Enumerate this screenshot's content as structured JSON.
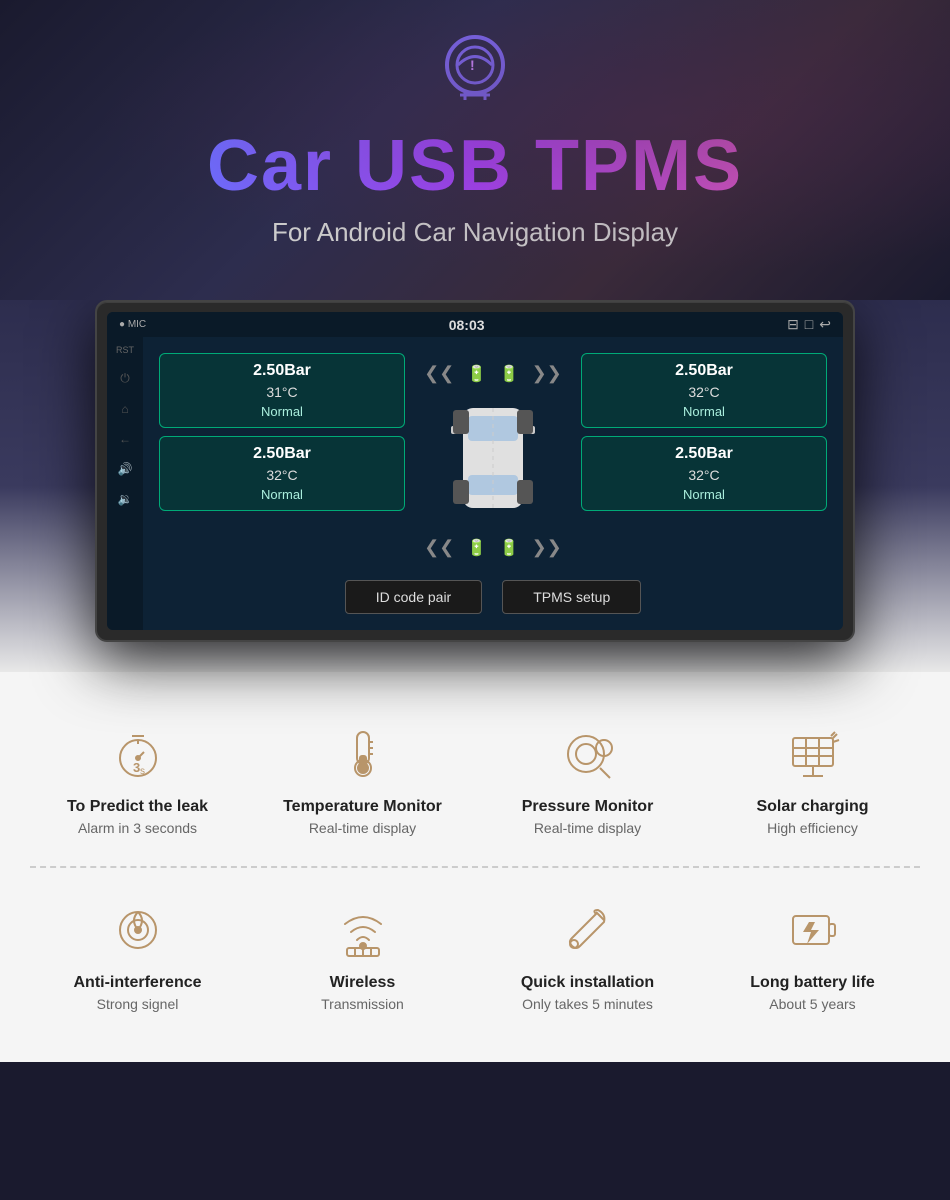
{
  "hero": {
    "icon_label": "TPMS tire pressure icon",
    "title": "Car USB TPMS",
    "subtitle": "For Android Car Navigation Display"
  },
  "device": {
    "topbar": {
      "left": "MIC  RST",
      "time": "08:03",
      "right_icons": [
        "≡",
        "□",
        "↩"
      ]
    },
    "sidebar_icons": [
      "⌂",
      "↩",
      "↑",
      "↓"
    ],
    "tires": {
      "front_left": {
        "bar": "2.50Bar",
        "temp": "31°C",
        "status": "Normal"
      },
      "front_right": {
        "bar": "2.50Bar",
        "temp": "32°C",
        "status": "Normal"
      },
      "rear_left": {
        "bar": "2.50Bar",
        "temp": "32°C",
        "status": "Normal"
      },
      "rear_right": {
        "bar": "2.50Bar",
        "temp": "32°C",
        "status": "Normal"
      }
    },
    "buttons": {
      "id_code": "ID code pair",
      "tpms_setup": "TPMS setup"
    }
  },
  "features_row1": [
    {
      "id": "predict-leak",
      "title": "To Predict the leak",
      "desc": "Alarm in 3 seconds",
      "icon": "timer"
    },
    {
      "id": "temperature",
      "title": "Temperature Monitor",
      "desc": "Real-time display",
      "icon": "thermometer"
    },
    {
      "id": "pressure",
      "title": "Pressure Monitor",
      "desc": "Real-time display",
      "icon": "pressure"
    },
    {
      "id": "solar",
      "title": "Solar charging",
      "desc": "High efficiency",
      "icon": "solar"
    }
  ],
  "features_row2": [
    {
      "id": "anti-interference",
      "title": "Anti-interference",
      "desc": "Strong signel",
      "icon": "signal"
    },
    {
      "id": "wireless",
      "title": "Wireless",
      "desc": "Transmission",
      "icon": "wireless"
    },
    {
      "id": "quick-install",
      "title": "Quick installation",
      "desc": "Only takes 5 minutes",
      "icon": "wrench"
    },
    {
      "id": "battery",
      "title": "Long battery life",
      "desc": "About 5 years",
      "icon": "battery"
    }
  ]
}
